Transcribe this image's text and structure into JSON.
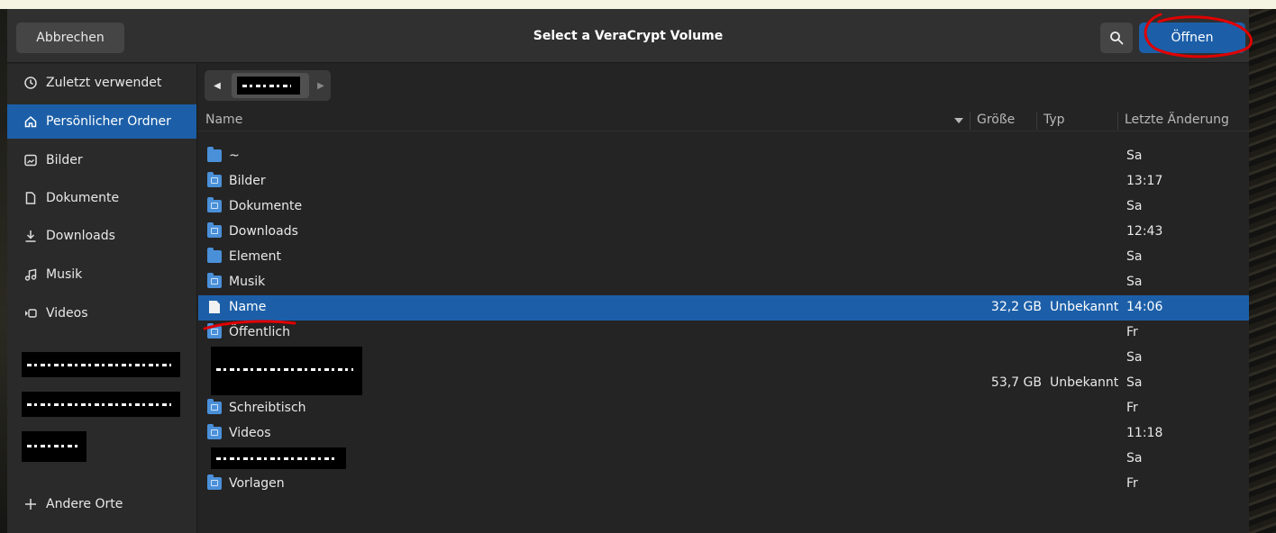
{
  "window": {
    "title": "Select a VeraCrypt Volume",
    "cancel_label": "Abbrechen",
    "open_label": "Öffnen"
  },
  "colors": {
    "accent": "#1c5fa8",
    "folder": "#4a90d9",
    "annotation": "#e00000"
  },
  "icons": {
    "search": "search-icon",
    "recent": "clock-icon",
    "home": "home-icon",
    "pictures": "image-icon",
    "documents": "document-icon",
    "downloads": "download-icon",
    "music": "music-icon",
    "videos": "video-icon",
    "other": "plus-icon"
  },
  "sidebar": {
    "items": [
      {
        "label": "Zuletzt verwendet"
      },
      {
        "label": "Persönlicher Ordner"
      },
      {
        "label": "Bilder"
      },
      {
        "label": "Dokumente"
      },
      {
        "label": "Downloads"
      },
      {
        "label": "Musik"
      },
      {
        "label": "Videos"
      }
    ],
    "other_locations": "Andere Orte"
  },
  "columns": {
    "name": "Name",
    "size": "Größe",
    "type": "Typ",
    "modified": "Letzte Änderung"
  },
  "files": [
    {
      "name": "~",
      "size": "",
      "type": "",
      "modified": "Sa"
    },
    {
      "name": "Bilder",
      "size": "",
      "type": "",
      "modified": "13:17"
    },
    {
      "name": "Dokumente",
      "size": "",
      "type": "",
      "modified": "Sa"
    },
    {
      "name": "Downloads",
      "size": "",
      "type": "",
      "modified": "12:43"
    },
    {
      "name": "Element",
      "size": "",
      "type": "",
      "modified": "Sa"
    },
    {
      "name": "Musik",
      "size": "",
      "type": "",
      "modified": "Sa"
    },
    {
      "name": "Name",
      "size": "32,2 GB",
      "type": "Unbekannt",
      "modified": "14:06"
    },
    {
      "name": "Öffentlich",
      "size": "",
      "type": "",
      "modified": "Fr"
    },
    {
      "name": "",
      "size": "",
      "type": "",
      "modified": "Sa"
    },
    {
      "name": "",
      "size": "53,7 GB",
      "type": "Unbekannt",
      "modified": "Sa"
    },
    {
      "name": "Schreibtisch",
      "size": "",
      "type": "",
      "modified": "Fr"
    },
    {
      "name": "Videos",
      "size": "",
      "type": "",
      "modified": "11:18"
    },
    {
      "name": "",
      "size": "",
      "type": "",
      "modified": "Sa"
    },
    {
      "name": "Vorlagen",
      "size": "",
      "type": "",
      "modified": "Fr"
    }
  ]
}
